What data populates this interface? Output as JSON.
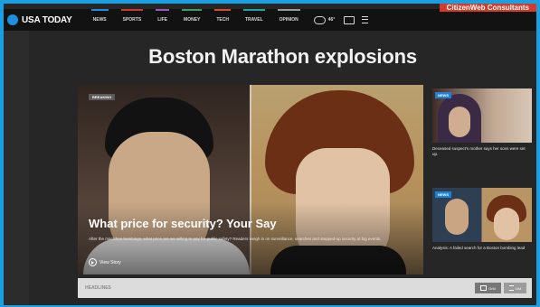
{
  "corner_label": "CitizenWeb Consultants",
  "brand": {
    "logo_text": "USA TODAY"
  },
  "nav": {
    "items": [
      {
        "label": "NEWS",
        "accent": "#1c8fe0"
      },
      {
        "label": "SPORTS",
        "accent": "#cc3b2a"
      },
      {
        "label": "LIFE",
        "accent": "#9c59b6"
      },
      {
        "label": "MONEY",
        "accent": "#3aa05c"
      },
      {
        "label": "TECH",
        "accent": "#d94b2a"
      },
      {
        "label": "TRAVEL",
        "accent": "#1aa7a1"
      },
      {
        "label": "OPINION",
        "accent": "#9a9a9a"
      }
    ],
    "weather_temp": "46°"
  },
  "page_title": "Boston Marathon explosions",
  "hero": {
    "tag": "BREAKING",
    "headline": "What price for security? Your Say",
    "summary": "After the marathon bombings, what price are we willing to pay for public safety? Readers weigh in on surveillance, searches and stepped-up security at big events.",
    "view_story": "View Story"
  },
  "side_cards": [
    {
      "badge": "NEWS",
      "caption": "Deceased suspect's mother says her sons were set up."
    },
    {
      "badge": "NEWS",
      "caption": "Analysis: A failed search for a Boston bombing lead"
    }
  ],
  "bottom_bar": {
    "label": "HEADLINES",
    "grid_label": "Grid",
    "list_label": "List"
  }
}
